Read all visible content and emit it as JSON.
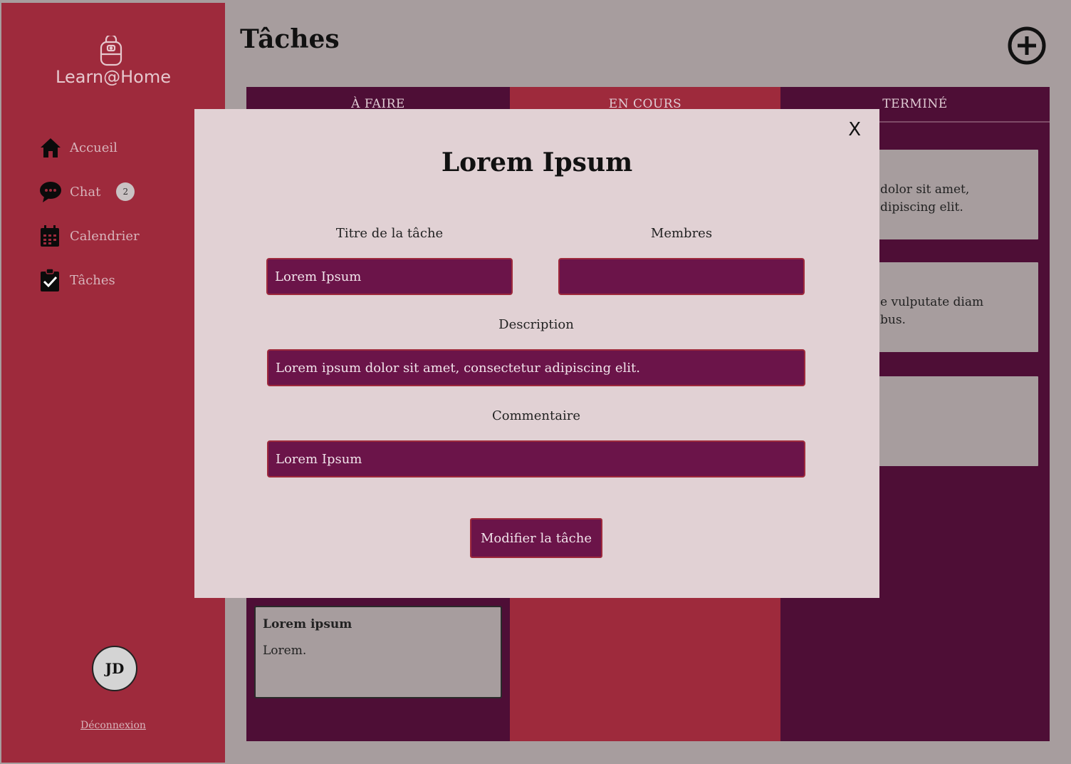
{
  "app": {
    "name": "Learn@Home"
  },
  "sidebar": {
    "items": [
      {
        "label": "Accueil",
        "icon": "home-icon"
      },
      {
        "label": "Chat",
        "icon": "chat-icon",
        "badge": "2"
      },
      {
        "label": "Calendrier",
        "icon": "calendar-icon"
      },
      {
        "label": "Tâches",
        "icon": "tasks-icon"
      }
    ],
    "avatar": "JD",
    "logout": "Déconnexion"
  },
  "page": {
    "title": "Tâches"
  },
  "board": {
    "columns": [
      {
        "title": "À FAIRE"
      },
      {
        "title": "EN COURS"
      },
      {
        "title": "TERMINÉ"
      }
    ],
    "done_cards": [
      {
        "line1": "dolor sit amet,",
        "line2": "dipiscing elit."
      },
      {
        "line1": "e vulputate diam",
        "line2": "bus."
      },
      {
        "line1": "",
        "line2": ""
      }
    ],
    "todo_card": {
      "title": "Lorem ipsum",
      "body": "Lorem."
    }
  },
  "modal": {
    "close": "X",
    "title": "Lorem Ipsum",
    "task_title_label": "Titre de la tâche",
    "task_title_value": "Lorem Ipsum",
    "members_label": "Membres",
    "members_value": "",
    "description_label": "Description",
    "description_value": "Lorem ipsum dolor sit amet, consectetur adipiscing elit.",
    "comment_label": "Commentaire",
    "comment_value": "Lorem Ipsum",
    "submit": "Modifier la tâche"
  },
  "colors": {
    "sidebar": "#9e2a3c",
    "column_dark": "#4e0e36",
    "field": "#6b1449",
    "modal_bg": "#e1d1d4",
    "page_bg": "#a79d9e"
  }
}
